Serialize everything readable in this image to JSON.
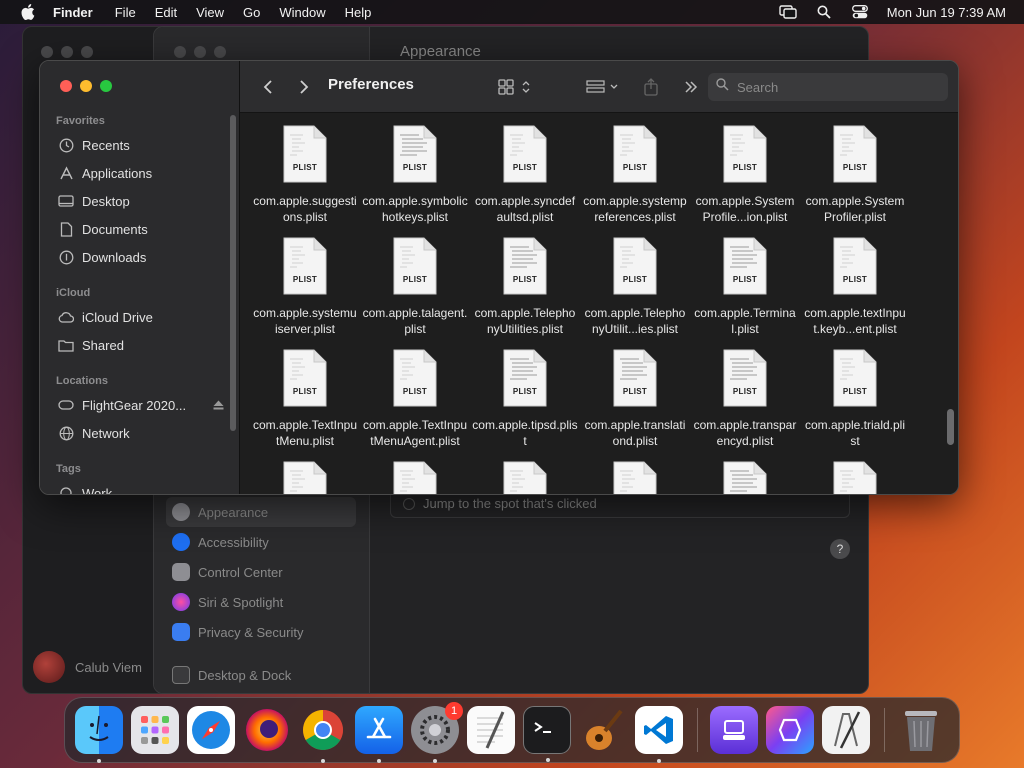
{
  "menubar": {
    "app_name": "Finder",
    "items": [
      "File",
      "Edit",
      "View",
      "Go",
      "Window",
      "Help"
    ],
    "datetime": "Mon Jun 19  7:39 AM",
    "icons": [
      "apple-icon",
      "screen-mirroring-icon",
      "spotlight-search-icon",
      "control-center-icon"
    ]
  },
  "background_window": {
    "title": "Appearance",
    "sidebar_items": [
      {
        "label": "Appearance",
        "color": "#8e8e93"
      },
      {
        "label": "Accessibility",
        "color": "#1e6ff2"
      },
      {
        "label": "Control Center",
        "color": "#8e8e93"
      },
      {
        "label": "Siri & Spotlight",
        "color": "#c44cf0"
      },
      {
        "label": "Privacy & Security",
        "color": "#3a7df0"
      },
      {
        "label": "Desktop & Dock",
        "color": "#3a3a3c"
      }
    ],
    "option_text": "Jump to the spot that's clicked",
    "help": "?",
    "user": "Calub Viem"
  },
  "finder": {
    "title": "Preferences",
    "search_placeholder": "Search",
    "sidebar": {
      "favorites_header": "Favorites",
      "favorites": [
        "Recents",
        "Applications",
        "Desktop",
        "Documents",
        "Downloads"
      ],
      "icloud_header": "iCloud",
      "icloud": [
        "iCloud Drive",
        "Shared"
      ],
      "locations_header": "Locations",
      "locations": [
        "FlightGear 2020...",
        "Network"
      ],
      "tags_header": "Tags",
      "tags": [
        "Work"
      ]
    },
    "file_badge": "PLIST",
    "files": [
      "com.apple.suggestions.plist",
      "com.apple.symbolichotkeys.plist",
      "com.apple.syncdefaultsd.plist",
      "com.apple.systempreferences.plist",
      "com.apple.SystemProfile...ion.plist",
      "com.apple.SystemProfiler.plist",
      "com.apple.systemuiserver.plist",
      "com.apple.talagent.plist",
      "com.apple.TelephonyUtilities.plist",
      "com.apple.TelephonyUtilit...ies.plist",
      "com.apple.Terminal.plist",
      "com.apple.textInput.keyb...ent.plist",
      "com.apple.TextInputMenu.plist",
      "com.apple.TextInputMenuAgent.plist",
      "com.apple.tipsd.plist",
      "com.apple.translationd.plist",
      "com.apple.transparencyd.plist",
      "com.apple.triald.plist"
    ]
  },
  "dock": {
    "apps": [
      {
        "name": "finder",
        "running": true
      },
      {
        "name": "launchpad",
        "running": false
      },
      {
        "name": "safari",
        "running": false
      },
      {
        "name": "firefox",
        "running": false
      },
      {
        "name": "chrome",
        "running": true
      },
      {
        "name": "app-store",
        "running": true
      },
      {
        "name": "system-settings",
        "running": true,
        "badge": "1"
      },
      {
        "name": "textedit",
        "running": false
      },
      {
        "name": "terminal",
        "running": true
      },
      {
        "name": "garageband",
        "running": false
      },
      {
        "name": "vscode",
        "running": true
      }
    ],
    "recent_apps": [
      "podcasts-utility",
      "shortcuts",
      "script-editor"
    ],
    "trash": "trash"
  }
}
